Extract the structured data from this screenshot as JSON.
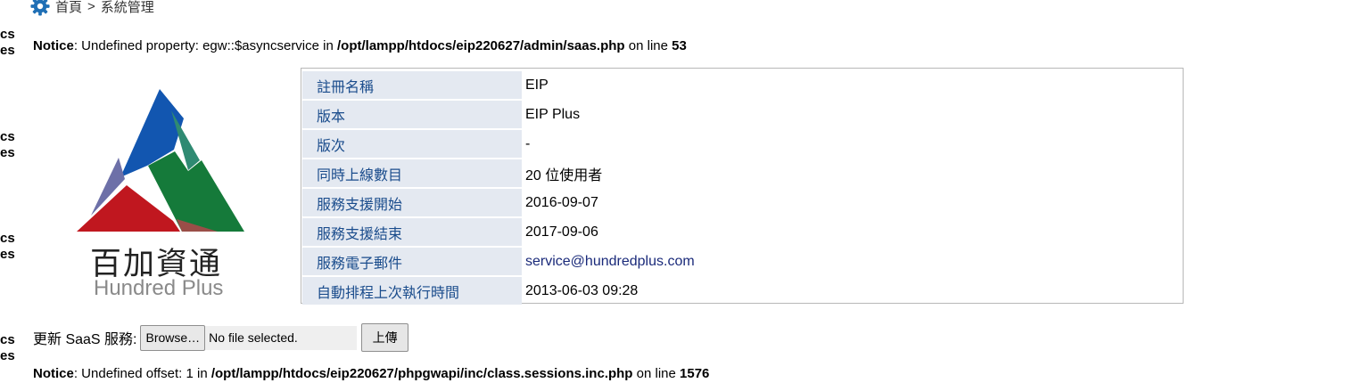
{
  "breadcrumb": {
    "home": "首頁",
    "sep": ">",
    "current": "系統管理",
    "icon": "gear-icon"
  },
  "left_cut": [
    "cs",
    "es"
  ],
  "notice1": {
    "label": "Notice",
    "text1": ": Undefined property: egw::$asyncservice in ",
    "path": "/opt/lampp/htdocs/eip220627/admin/saas.php",
    "text2": " on line ",
    "line": "53"
  },
  "logo": {
    "cn": "百加資通",
    "en": "Hundred Plus"
  },
  "info_rows": [
    {
      "key": "註冊名稱",
      "value": "EIP"
    },
    {
      "key": "版本",
      "value": "EIP Plus"
    },
    {
      "key": "版次",
      "value": "-"
    },
    {
      "key": "同時上線數目",
      "value": "20 位使用者"
    },
    {
      "key": "服務支援開始",
      "value": "2016-09-07"
    },
    {
      "key": "服務支援結束",
      "value": "2017-09-06"
    },
    {
      "key": "服務電子郵件",
      "value": "service@hundredplus.com"
    },
    {
      "key": "自動排程上次執行時間",
      "value": "2013-06-03 09:28"
    }
  ],
  "upload": {
    "label": "更新 SaaS 服務:",
    "browse": "Browse…",
    "filename": "No file selected.",
    "submit": "上傳"
  },
  "notice2": {
    "label": "Notice",
    "text1": ": Undefined offset: 1 in ",
    "path": "/opt/lampp/htdocs/eip220627/phpgwapi/inc/class.sessions.inc.php",
    "text2": " on line ",
    "line": "1576"
  },
  "colors": {
    "key_bg": "#e4e9f1",
    "key_text": "#1a4c8c",
    "gear": "#1f6fb5"
  }
}
